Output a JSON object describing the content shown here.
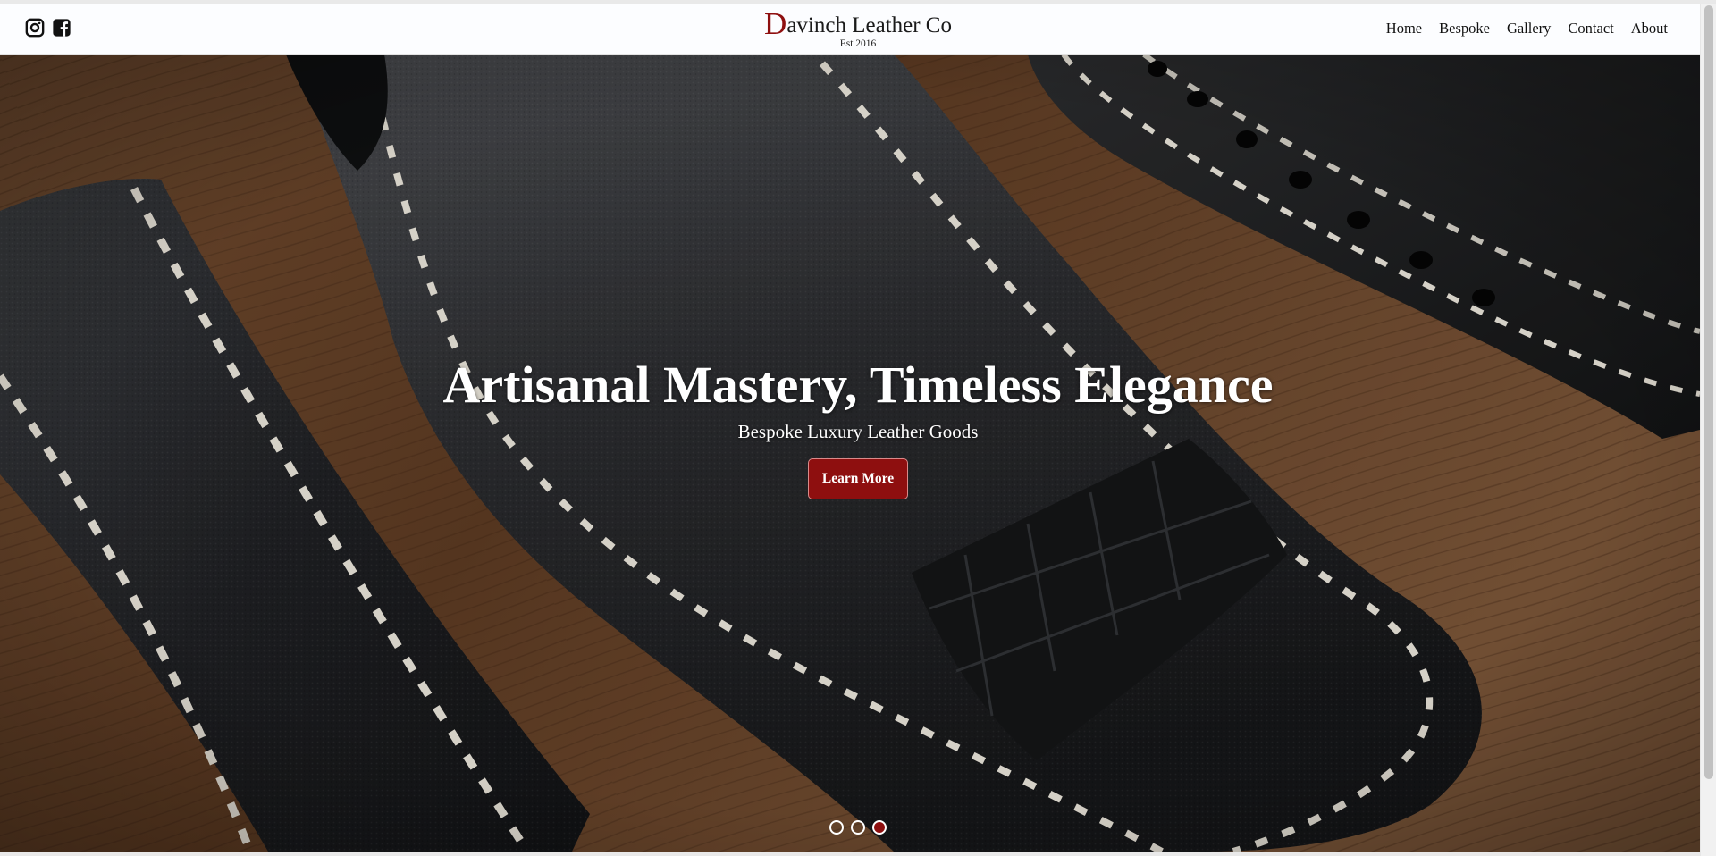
{
  "social": {
    "instagram_icon": "instagram-icon",
    "facebook_icon": "facebook-icon"
  },
  "brand": {
    "initial": "D",
    "rest": "avinch Leather Co",
    "established": "Est 2016"
  },
  "nav": {
    "items": [
      "Home",
      "Bespoke",
      "Gallery",
      "Contact",
      "About"
    ]
  },
  "hero": {
    "headline": "Artisanal Mastery, Timeless Elegance",
    "subheadline": "Bespoke Luxury Leather Goods",
    "cta_label": "Learn More",
    "slides_total": 3,
    "active_slide": 3
  },
  "colors": {
    "accent": "#8e0f0f",
    "header_bg": "#fcfdff",
    "wood": "#6b4428",
    "leather": "#1c1c1c",
    "stitch": "#e8e3d8"
  }
}
